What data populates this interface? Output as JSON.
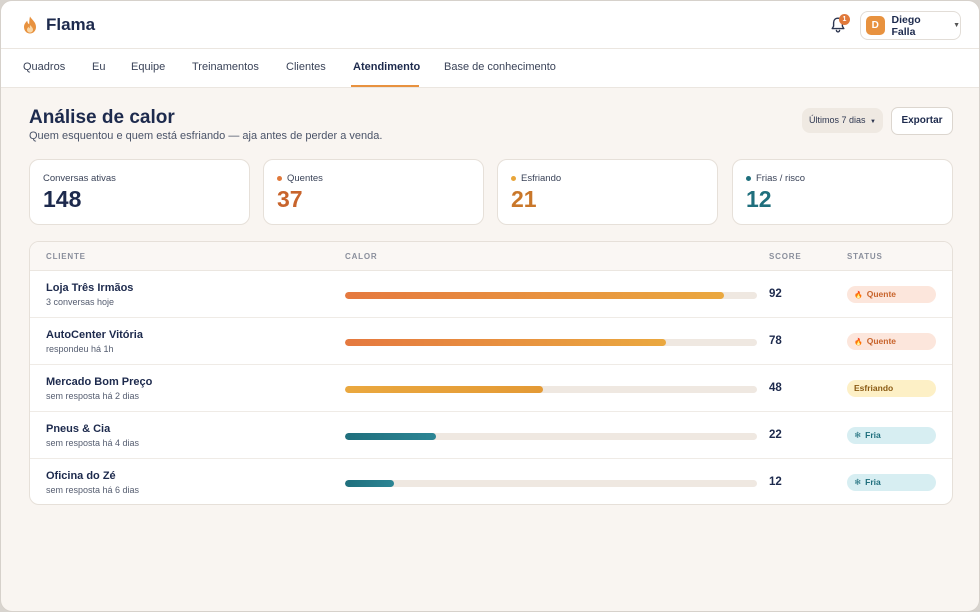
{
  "app": {
    "name": "Flama"
  },
  "notifications": {
    "count": "1"
  },
  "user": {
    "initial": "D",
    "name": "Diego Falla"
  },
  "nav": {
    "items": [
      "Quadros",
      "Eu",
      "Equipe",
      "Treinamentos",
      "Clientes",
      "Atendimento",
      "Base de conhecimento"
    ],
    "active": "Atendimento"
  },
  "header": {
    "title": "Análise de calor",
    "subtitle": "Quem esquentou e quem está esfriando — aja antes de perder a venda.",
    "range_label": "Últimos 7 dias",
    "export_label": "Exportar"
  },
  "stats": [
    {
      "label": "Conversas ativas",
      "value": "148",
      "dot_color": "",
      "value_color": "#1d2a4d"
    },
    {
      "label": "Quentes",
      "value": "37",
      "dot_color": "#e0793b",
      "value_color": "#c8642c"
    },
    {
      "label": "Esfriando",
      "value": "21",
      "dot_color": "#e8a53a",
      "value_color": "#c9772a"
    },
    {
      "label": "Frias / risco",
      "value": "12",
      "dot_color": "#1f6f7d",
      "value_color": "#1f6f7d"
    }
  ],
  "table": {
    "columns": [
      "CLIENTE",
      "CALOR",
      "SCORE",
      "STATUS"
    ],
    "rows": [
      {
        "name": "Loja Três Irmãos",
        "sub": "3 conversas hoje",
        "score": 92,
        "status": "Quente",
        "status_icon": "flame-icon",
        "heat": "hot"
      },
      {
        "name": "AutoCenter Vitória",
        "sub": "respondeu há 1h",
        "score": 78,
        "status": "Quente",
        "status_icon": "flame-icon",
        "heat": "hot"
      },
      {
        "name": "Mercado Bom Preço",
        "sub": "sem resposta há 2 dias",
        "score": 48,
        "status": "Esfriando",
        "status_icon": "",
        "heat": "warm"
      },
      {
        "name": "Pneus & Cia",
        "sub": "sem resposta há 4 dias",
        "score": 22,
        "status": "Fria",
        "status_icon": "snowflake-icon",
        "heat": "cold"
      },
      {
        "name": "Oficina do Zé",
        "sub": "sem resposta há 6 dias",
        "score": 12,
        "status": "Fria",
        "status_icon": "snowflake-icon",
        "heat": "cold"
      }
    ]
  },
  "colors": {
    "accent": "#e8923f",
    "hot_badge_bg": "#fce6dc",
    "hot_badge_text": "#c8642c",
    "warm_badge_bg": "#fdf0c6",
    "warm_badge_text": "#8a5a12",
    "cold_badge_bg": "#d7eef2",
    "cold_badge_text": "#1f6f7d"
  }
}
